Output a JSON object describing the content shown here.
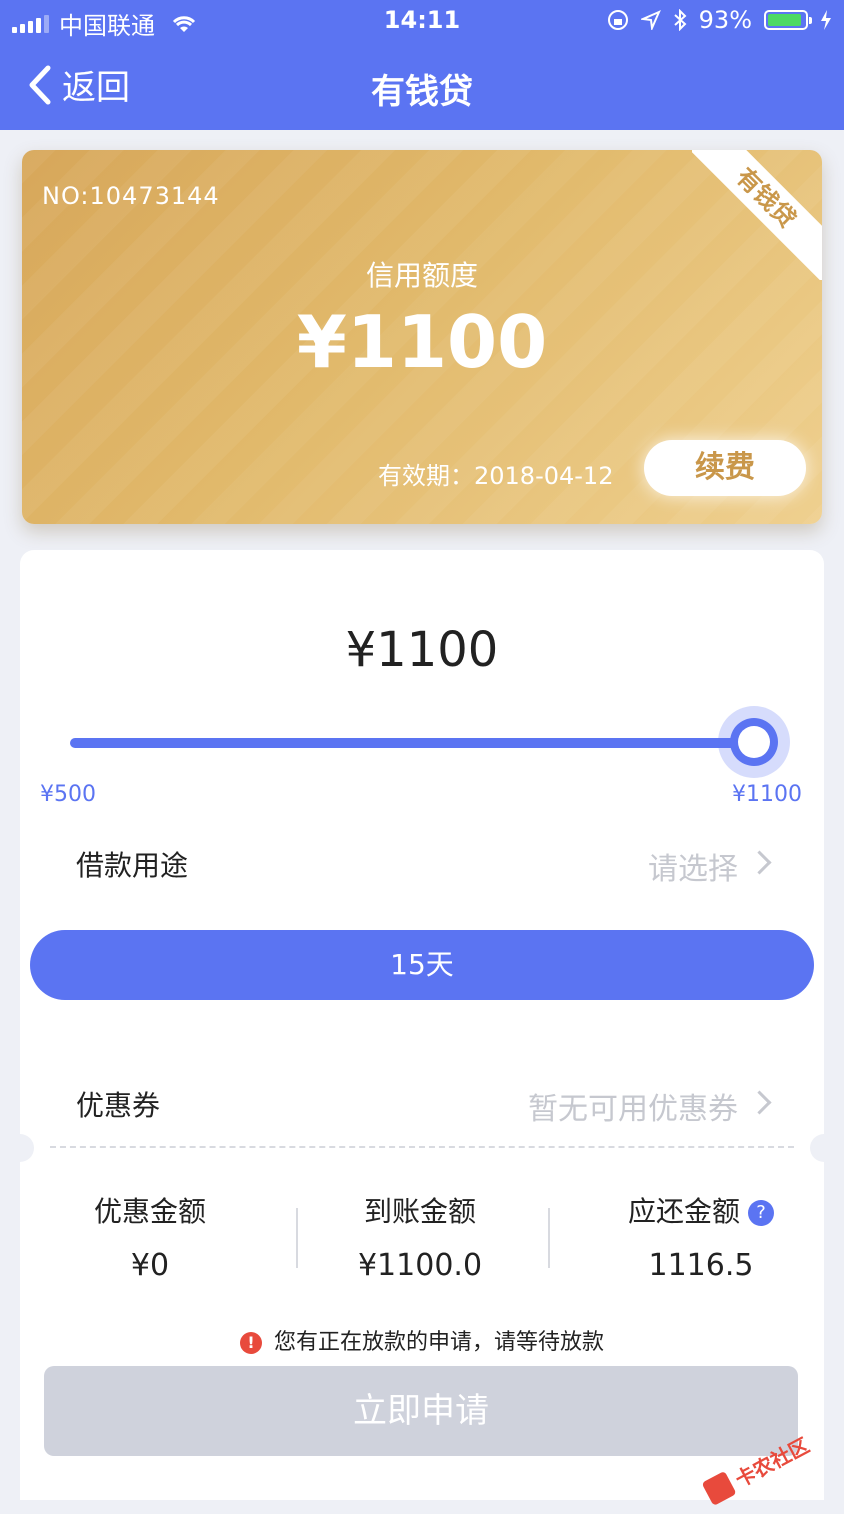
{
  "status_bar": {
    "carrier": "中国联通",
    "time": "14:11",
    "battery": "93%",
    "battery_level": 0.93
  },
  "nav": {
    "back_label": "返回",
    "title": "有钱贷"
  },
  "card": {
    "number": "NO:10473144",
    "credit_label": "信用额度",
    "credit_amount": "¥1100",
    "validity": "有效期：2018-04-12",
    "renew_label": "续费",
    "ribbon": "有钱贷"
  },
  "loan": {
    "amount": "¥1100",
    "slider": {
      "min_label": "¥500",
      "max_label": "¥1100",
      "value_fraction": 1.0
    },
    "purpose": {
      "label": "借款用途",
      "placeholder": "请选择"
    },
    "term_button": "15天",
    "coupon": {
      "label": "优惠券",
      "value": "暂无可用优惠券"
    }
  },
  "summary": {
    "discount": {
      "label": "优惠金额",
      "value": "¥0"
    },
    "received": {
      "label": "到账金额",
      "value": "¥1100.0"
    },
    "repay": {
      "label": "应还金额",
      "value": "1116.5"
    },
    "help_symbol": "?"
  },
  "notice": {
    "icon": "!",
    "text": "您有正在放款的申请，请等待放款"
  },
  "apply_button": "立即申请",
  "watermark": {
    "text": "卡农社区"
  },
  "colors": {
    "primary": "#5b74f2",
    "gold": "#d9ad62",
    "disabled": "#cfd2dc",
    "warning": "#e84a3c"
  }
}
